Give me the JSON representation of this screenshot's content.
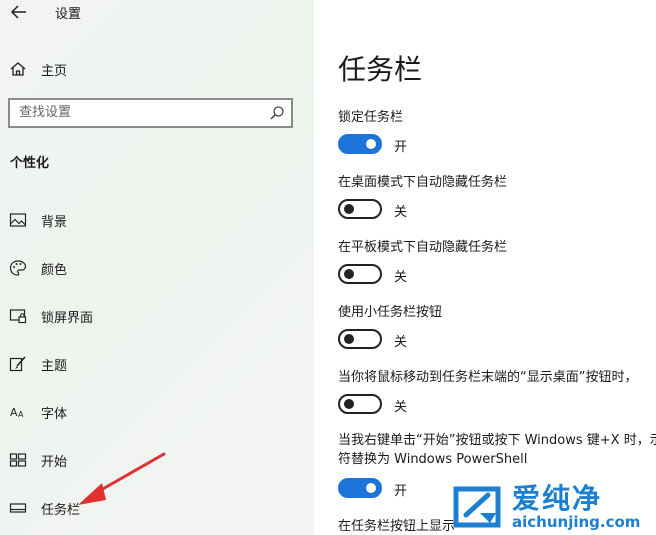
{
  "window": {
    "title": "设置"
  },
  "sidebar": {
    "home_label": "主页",
    "search_placeholder": "查找设置",
    "section_title": "个性化",
    "items": [
      {
        "label": "背景",
        "icon": "picture-icon"
      },
      {
        "label": "颜色",
        "icon": "palette-icon"
      },
      {
        "label": "锁屏界面",
        "icon": "lock-screen-icon"
      },
      {
        "label": "主题",
        "icon": "theme-brush-icon"
      },
      {
        "label": "字体",
        "icon": "font-icon"
      },
      {
        "label": "开始",
        "icon": "start-icon"
      },
      {
        "label": "任务栏",
        "icon": "taskbar-icon"
      }
    ]
  },
  "main": {
    "title": "任务栏",
    "settings": [
      {
        "label": "锁定任务栏",
        "state": "开",
        "on": true
      },
      {
        "label": "在桌面模式下自动隐藏任务栏",
        "state": "关",
        "on": false
      },
      {
        "label": "在平板模式下自动隐藏任务栏",
        "state": "关",
        "on": false
      },
      {
        "label": "使用小任务栏按钮",
        "state": "关",
        "on": false
      },
      {
        "label": "当你将鼠标移动到任务栏末端的“显示桌面”按钮时，",
        "state": "关",
        "on": false
      },
      {
        "label": "当我右键单击“开始”按钮或按下 Windows 键+X 时，示符替换为 Windows PowerShell",
        "state": "开",
        "on": true
      },
      {
        "label": "在任务栏按钮上显示"
      }
    ]
  },
  "watermark": {
    "text_cn": "爱纯净",
    "url": "aichunjing.com"
  },
  "colors": {
    "accent": "#1e73d8",
    "annotation_arrow": "#e03030",
    "watermark": "#1c7fd0"
  }
}
